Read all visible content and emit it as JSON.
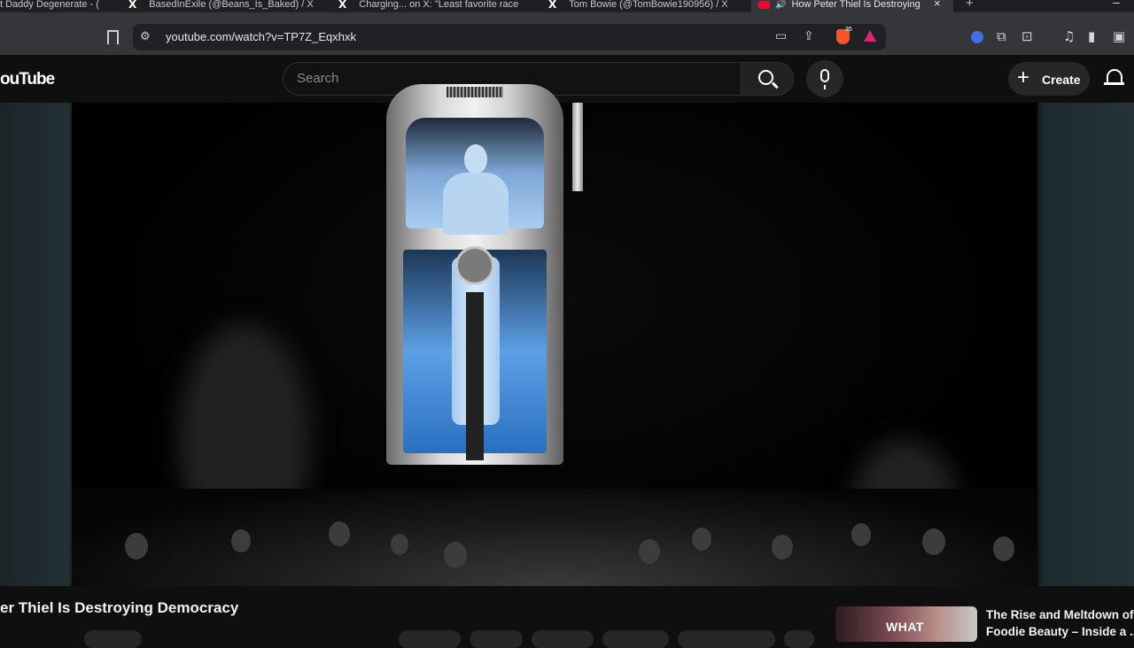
{
  "browser": {
    "tabs": [
      {
        "label": "t Daddy Degenerate - (",
        "icon": "none"
      },
      {
        "label": "BasedInExile (@Beans_Is_Baked) / X",
        "icon": "x-logo-icon"
      },
      {
        "label": "Charging... on X: \"Least favorite race",
        "icon": "x-logo-icon"
      },
      {
        "label": "Tom Bowie (@TomBowie190956) / X",
        "icon": "x-logo-icon"
      },
      {
        "label": "How Peter Thiel Is Destroying",
        "icon": "youtube-icon",
        "active": true
      }
    ],
    "x_glyph": "X",
    "close_glyph": "×",
    "new_tab_glyph": "+",
    "minimize_glyph": "–",
    "speaker_glyph": "🔊",
    "url": "youtube.com/watch?v=TP7Z_Eqxhxk",
    "brave_badge": "35"
  },
  "youtube": {
    "logo": "ouTube",
    "search_placeholder": "Search",
    "create_label": "Create",
    "create_glyph": "+"
  },
  "video": {
    "title": "er Thiel Is Destroying Democracy"
  },
  "recommendation": {
    "thumb_text": "WHAT",
    "title_line1": "The Rise and Meltdown of",
    "title_line2": "Foodie Beauty – Inside a ..."
  },
  "colors": {
    "background": "#0f0f0f",
    "browser_toolbar": "#35363a",
    "youtube_red": "#ff0033"
  }
}
